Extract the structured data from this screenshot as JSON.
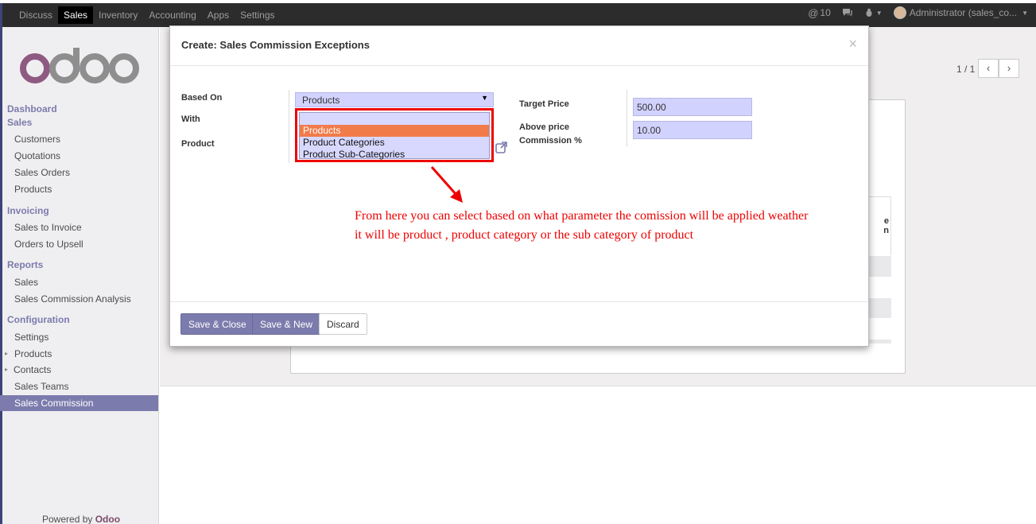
{
  "topbar": {
    "menu": [
      "Discuss",
      "Sales",
      "Inventory",
      "Accounting",
      "Apps",
      "Settings"
    ],
    "active_menu": "Sales",
    "mentions_count": "10",
    "user": "Administrator (sales_co..."
  },
  "sidebar": {
    "logo_text": "odoo",
    "sections": {
      "dashboard": "Dashboard",
      "sales": "Sales",
      "sales_items": [
        "Customers",
        "Quotations",
        "Sales Orders",
        "Products"
      ],
      "invoicing": "Invoicing",
      "invoicing_items": [
        "Sales to Invoice",
        "Orders to Upsell"
      ],
      "reports": "Reports",
      "reports_items": [
        "Sales",
        "Sales Commission Analysis"
      ],
      "configuration": "Configuration",
      "configuration_items": [
        "Settings",
        "Products",
        "Contacts",
        "Sales Teams",
        "Sales Commission"
      ]
    },
    "active_item": "Sales Commission",
    "powered_by": "Powered by",
    "powered_brand": "Odoo"
  },
  "pager": {
    "value": "1 / 1",
    "prev": "‹",
    "next": "›"
  },
  "background_partial": {
    "col_a": "e",
    "col_b": "n"
  },
  "modal": {
    "title": "Create: Sales Commission Exceptions",
    "close": "×",
    "labels": {
      "based_on": "Based On",
      "with": "With",
      "product": "Product",
      "target_price": "Target Price",
      "above_price_1": "Above price",
      "above_price_2": "Commission %"
    },
    "based_on_value": "Products",
    "dropdown_options": [
      "Products",
      "Product Categories",
      "Product Sub-Categories"
    ],
    "dropdown_selected": "Products",
    "target_price_value": "500.00",
    "above_price_value": "10.00",
    "buttons": {
      "save_close": "Save & Close",
      "save_new": "Save & New",
      "discard": "Discard"
    }
  },
  "annotation": {
    "line1": "From here you can select based on what parameter the comission will be applied weather",
    "line2": "it will be product , product category or the sub category of product",
    "color": "#e00000"
  },
  "colors": {
    "brand": "#7c7bad",
    "topbar": "#2c2c2c",
    "field_bg": "#d2d2ff",
    "selected_option": "#f27b4a"
  }
}
